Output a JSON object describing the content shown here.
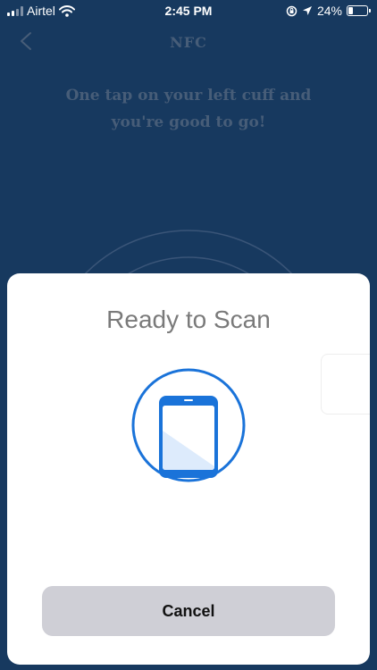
{
  "status_bar": {
    "carrier": "Airtel",
    "time": "2:45 PM",
    "battery_percent": "24%",
    "battery_level": 0.24
  },
  "nav": {
    "title": "NFC",
    "back_icon": "chevron-left-icon"
  },
  "main": {
    "instruction": "One tap on your left cuff and you're good to go!"
  },
  "scan_sheet": {
    "title": "Ready to Scan",
    "icon": "phone-scan-icon",
    "cancel_label": "Cancel"
  },
  "colors": {
    "background": "#17395f",
    "accent": "#1a73d9",
    "muted_text": "#475d78"
  }
}
